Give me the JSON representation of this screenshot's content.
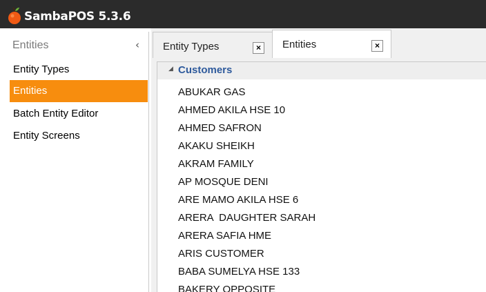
{
  "window": {
    "title": "SambaPOS 5.3.6",
    "icon": "samba-orange-icon"
  },
  "sidebar": {
    "title": "Entities",
    "collapse_icon": "chevron-left-icon",
    "items": [
      {
        "label": "Entity Types",
        "active": false
      },
      {
        "label": "Entities",
        "active": true
      },
      {
        "label": "Batch Entity Editor",
        "active": false
      },
      {
        "label": "Entity Screens",
        "active": false
      }
    ]
  },
  "tabs": [
    {
      "label": "Entity Types",
      "active": false,
      "close": "×"
    },
    {
      "label": "Entities",
      "active": true,
      "close": "×"
    }
  ],
  "list": {
    "group": "Customers",
    "rows": [
      "ABUKAR GAS",
      "AHMED AKILA HSE 10",
      "AHMED SAFRON",
      "AKAKU SHEIKH",
      "AKRAM FAMILY",
      "AP MOSQUE DENI",
      "ARE MAMO AKILA HSE 6",
      "ARERA  DAUGHTER SARAH",
      "ARERA SAFIA HME",
      "ARIS CUSTOMER",
      "BABA SUMELYA HSE 133",
      "BAKERY OPPOSITE"
    ]
  },
  "colors": {
    "accent": "#f78d0e",
    "group_label": "#2e5a9c",
    "titlebar": "#2b2b2b"
  }
}
